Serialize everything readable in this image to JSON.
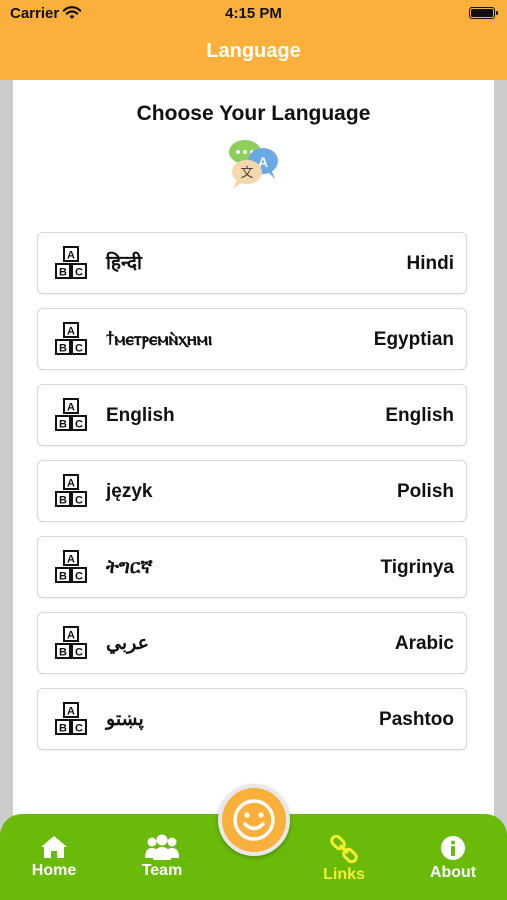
{
  "status_bar": {
    "carrier": "Carrier",
    "time": "4:15 PM"
  },
  "nav": {
    "title": "Language"
  },
  "card": {
    "title": "Choose Your Language"
  },
  "languages": [
    {
      "native": "हिन्दी",
      "english": "Hindi"
    },
    {
      "native": "ϯⲙⲉⲧⲣⲉⲙⲛ̀ⲭⲏⲙⲓ",
      "english": "Egyptian"
    },
    {
      "native": "English",
      "english": "English"
    },
    {
      "native": "język",
      "english": "Polish"
    },
    {
      "native": "ትግርኛ",
      "english": "Tigrinya"
    },
    {
      "native": "عربي",
      "english": "Arabic"
    },
    {
      "native": "پښتو",
      "english": "Pashtoo"
    }
  ],
  "tabs": {
    "home": "Home",
    "team": "Team",
    "links": "Links",
    "about": "About"
  },
  "colors": {
    "header": "#fbb03b",
    "tabbar": "#6aba0a",
    "active_tab": "#f6ee2e",
    "background": "#cccccc"
  },
  "icons": {
    "language_item": "abc-blocks-icon",
    "translate": "translate-icon",
    "center_button": "smiley-face-icon"
  }
}
